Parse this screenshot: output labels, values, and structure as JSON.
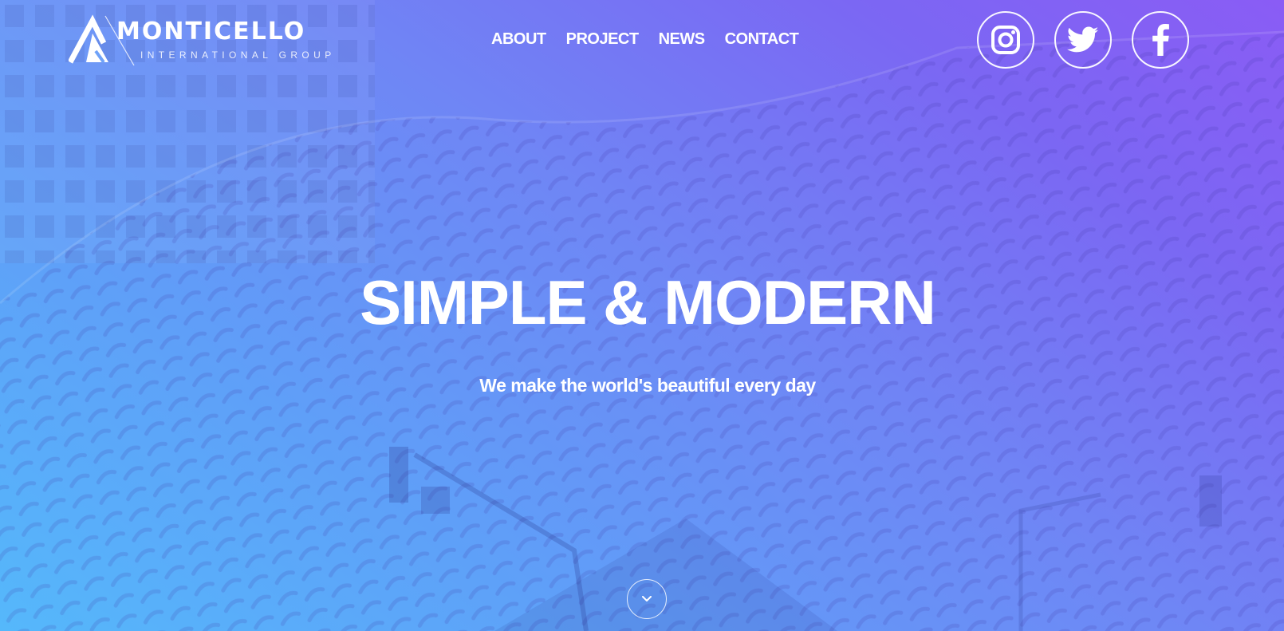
{
  "brand": {
    "name": "MONTICELLO",
    "subtitle": "INTERNATIONAL GROUP"
  },
  "nav": {
    "items": [
      {
        "label": "ABOUT"
      },
      {
        "label": "PROJECT"
      },
      {
        "label": "NEWS"
      },
      {
        "label": "CONTACT"
      }
    ]
  },
  "socials": [
    {
      "icon": "instagram-icon"
    },
    {
      "icon": "twitter-icon"
    },
    {
      "icon": "facebook-icon"
    }
  ],
  "hero": {
    "headline": "SIMPLE & MODERN",
    "tagline": "We make the world's beautiful every day",
    "scroll_icon": "chevron-down-icon"
  },
  "colors": {
    "gradient_start": "#55b8fb",
    "gradient_end": "#8a5cf5",
    "text": "#ffffff"
  }
}
